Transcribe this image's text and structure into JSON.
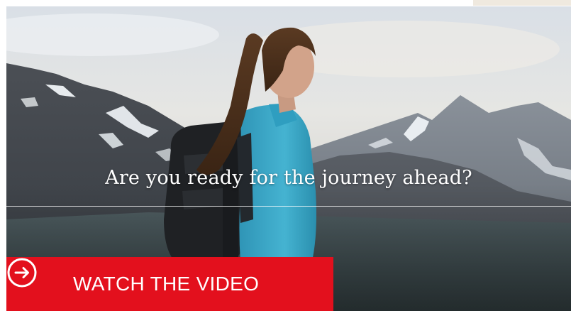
{
  "hero": {
    "headline": "Are you ready for the journey ahead?",
    "image_icon": "hiker-mountain-photo"
  },
  "cta": {
    "label": "WATCH THE VIDEO",
    "icon": "arrow-right-circle-icon",
    "color": "#e3101d"
  },
  "colors": {
    "accent": "#e3101d",
    "text_on_image": "#ffffff"
  }
}
